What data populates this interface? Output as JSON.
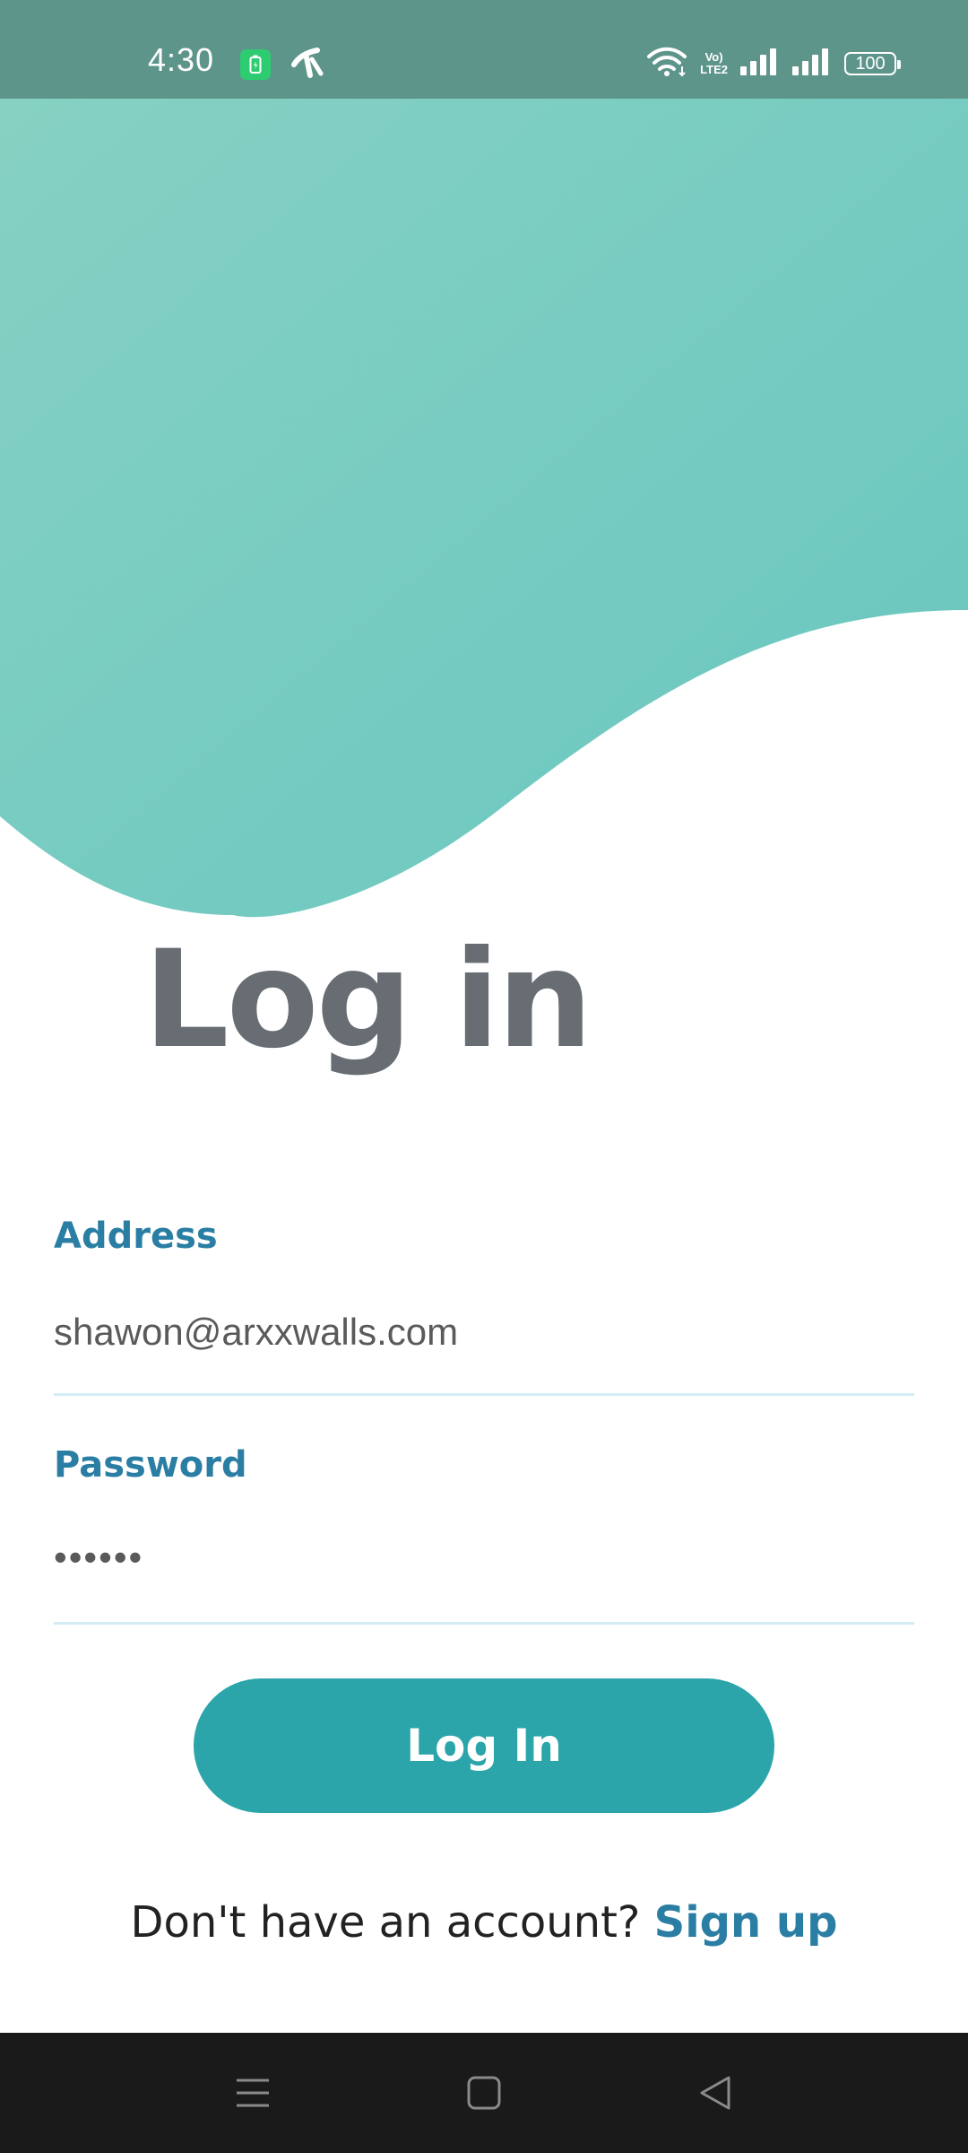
{
  "status_bar": {
    "time": "4:30",
    "network_type_top": "Vo)",
    "network_type_bottom": "LTE2",
    "battery_level": "100",
    "background_color": "#5e958b"
  },
  "header": {
    "gradient_start": "#86d1c2",
    "gradient_end": "#68c6c0"
  },
  "page": {
    "title": "Log in"
  },
  "form": {
    "address_label": "Address",
    "address_value": "shawon@arxxwalls.com",
    "password_label": "Password",
    "password_value": "••••••",
    "submit_label": "Log In",
    "accent_color": "#2b7ea3",
    "button_color": "#2ba5a9"
  },
  "signup": {
    "prompt": "Don't have an account? ",
    "link": "Sign up"
  },
  "navigation_bar": {
    "icons": [
      "menu-icon",
      "home-icon",
      "back-icon"
    ]
  }
}
